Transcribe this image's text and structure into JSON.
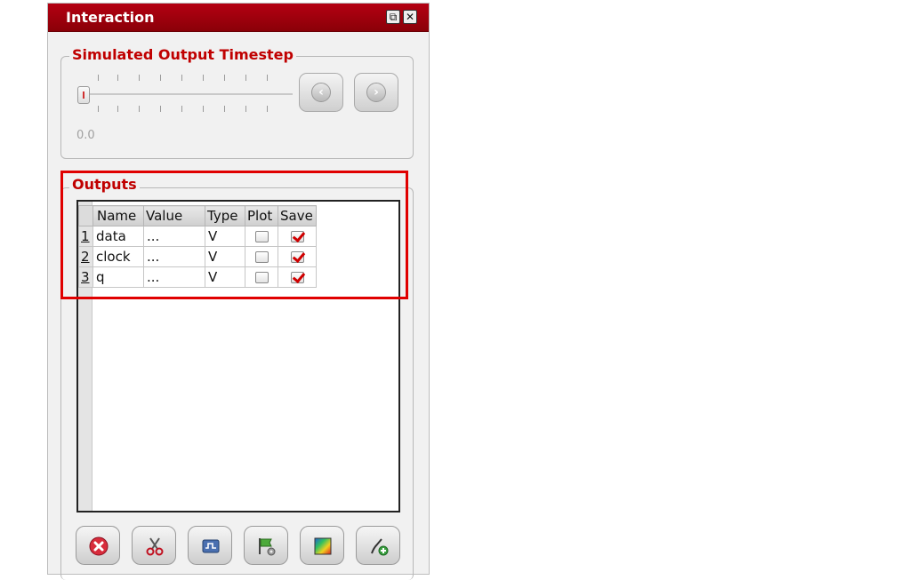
{
  "window": {
    "title": "Interaction",
    "float_icon": "restore-icon",
    "close_icon": "close-icon"
  },
  "timestep": {
    "legend": "Simulated Output Timestep",
    "value_text": "0.0",
    "slider_level": 0,
    "prev_icon": "arrow-left-icon",
    "next_icon": "arrow-right-icon"
  },
  "outputs": {
    "legend": "Outputs",
    "columns": [
      "Name",
      "Value",
      "Type",
      "Plot",
      "Save"
    ],
    "rows": [
      {
        "num": "1",
        "name": "data",
        "value": "...",
        "type": "V",
        "plot": false,
        "save": true
      },
      {
        "num": "2",
        "name": "clock",
        "value": "...",
        "type": "V",
        "plot": false,
        "save": true
      },
      {
        "num": "3",
        "name": "q",
        "value": "...",
        "type": "V",
        "plot": false,
        "save": true
      }
    ]
  },
  "toolbar": {
    "buttons": [
      "delete-icon",
      "cut-icon",
      "waveform-icon",
      "flag-settings-icon",
      "color-map-icon",
      "add-probe-icon"
    ]
  },
  "colors": {
    "title_bar": "#a0000c",
    "legend_text": "#c00000",
    "highlight_box": "#e00000",
    "checkmark": "#d00000"
  }
}
